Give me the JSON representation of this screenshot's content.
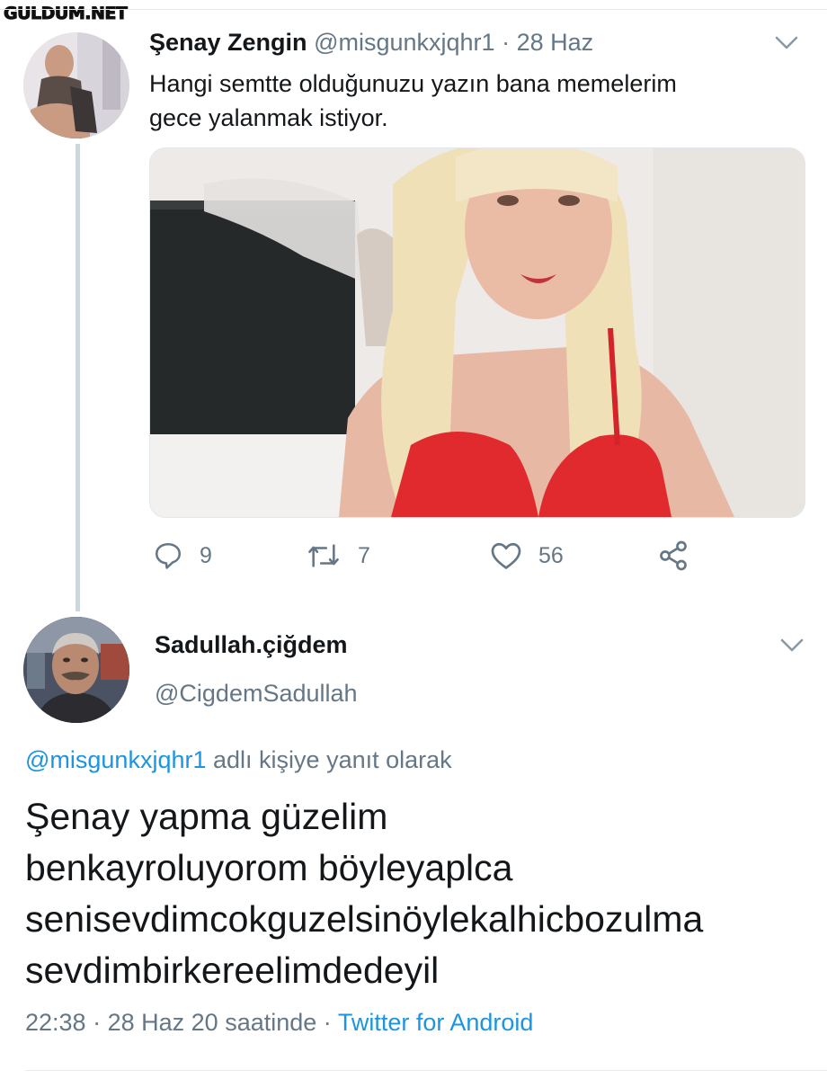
{
  "watermark": "GULDUM.NET",
  "tweet1": {
    "name": "Şenay Zengin",
    "handle": "@misgunkxjqhr1",
    "separator": "·",
    "date": "28 Haz",
    "text_line1": "Hangi semtte olduğunuzu yazın bana memelerim",
    "text_line2": "gece yalanmak istiyor.",
    "stats": {
      "replies": "9",
      "retweets": "7",
      "likes": "56"
    },
    "icons": [
      "reply-icon",
      "retweet-icon",
      "like-icon",
      "share-icon",
      "chevron-down-icon"
    ]
  },
  "tweet2": {
    "name": "Sadullah.çiğdem",
    "handle": "@CigdemSadullah",
    "reply_mention": "@misgunkxjqhr1",
    "reply_suffix": "adlı kişiye yanıt olarak",
    "text_lines": [
      "Şenay yapma güzelim",
      "benkayroluyorom böyleyaplca",
      "senisevdimcokguzelsinöylekalhicbozulma",
      "sevdimbirkereelimdedeyil"
    ],
    "time": "22:38",
    "date": "28 Haz 20 saatinde",
    "separator": "·",
    "source": "Twitter for Android"
  },
  "colors": {
    "link": "#1b95e0",
    "secondary": "#657786",
    "thread_line": "#ccd6dd"
  }
}
